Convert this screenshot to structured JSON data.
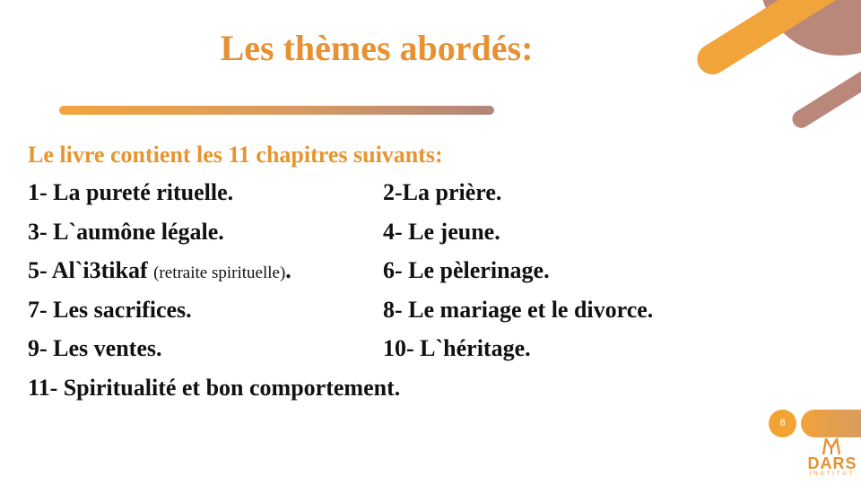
{
  "slide": {
    "title": "Les thèmes abordés:",
    "intro": "Le livre contient les 11 chapitres suivants:",
    "chapters": [
      {
        "left": "1- La pureté rituelle.",
        "right": "2-La prière."
      },
      {
        "left": "3- L`aumône légale.",
        "right": "4- Le jeune."
      },
      {
        "left_main": "5- Al`i3tikaf ",
        "left_note": "(retraite spirituelle)",
        "left_end": ".",
        "right": "6- Le pèlerinage."
      },
      {
        "left": "7- Les sacrifices.",
        "right": "8- Le mariage et le divorce."
      },
      {
        "left": "9- Les ventes.",
        "right": "10- L`héritage."
      },
      {
        "left": "11- Spiritualité et bon comportement."
      }
    ],
    "page_number": "8"
  },
  "logo": {
    "text": "DARS",
    "subtext": "INSTITUT",
    "icon": "dars-logo-mark"
  },
  "colors": {
    "accent_orange": "#e69234",
    "accent_brown": "#b9887a",
    "body_text": "#111111"
  }
}
